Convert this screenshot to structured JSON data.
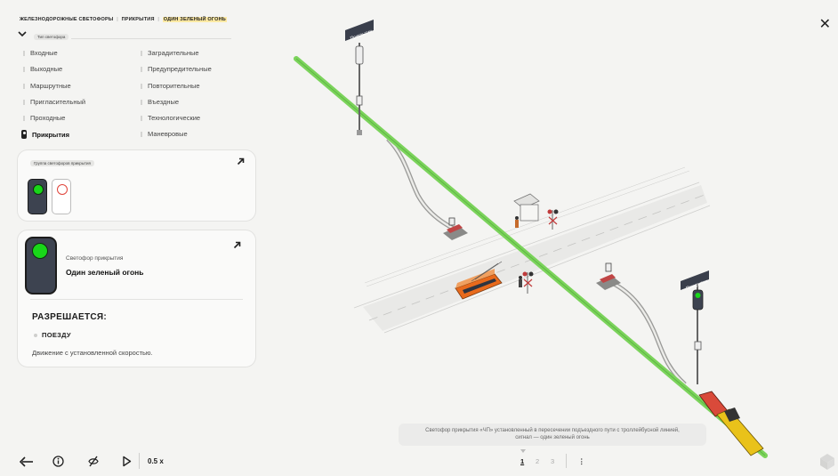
{
  "breadcrumb": {
    "part1": "Железнодорожные светофоры",
    "part2": "Прикрытия",
    "part3": "Один зеленый огонь",
    "sep": "|"
  },
  "close_label": "✕",
  "type_selector": {
    "chip_label": "Тип светофора"
  },
  "signal_types": {
    "left": [
      "Входные",
      "Выходные",
      "Маршрутные",
      "Пригласительный",
      "Проходные",
      "Прикрытия"
    ],
    "right": [
      "Заградительные",
      "Предупредительные",
      "Повторительные",
      "Въездные",
      "Технологические",
      "Маневровые"
    ],
    "active": "Прикрытия"
  },
  "group_card": {
    "chip_label": "Группа светофоров прикрытия"
  },
  "detail_card": {
    "sublabel": "Светофор прикрытия",
    "name": "Один зеленый огонь",
    "allowed_heading": "РАЗРЕШАЕТСЯ:",
    "target": "ПОЕЗДУ",
    "description": "Движение с установленной скоростью."
  },
  "scene": {
    "sign_top": "Прикрытия",
    "sign_right": "Прикрытия"
  },
  "caption": {
    "line1": "Светофор прикрытия «ЧП» установленный в пересечении подъездного пути с троллейбусной линией,",
    "line2": "сигнал — один зеленый огонь"
  },
  "controls": {
    "back_icon": "arrow-left-icon",
    "info_icon": "info-icon",
    "hide_icon": "eye-off-icon",
    "play_icon": "play-icon",
    "speed": "0.5 x"
  },
  "pagination": {
    "pages": [
      "1",
      "2",
      "3"
    ],
    "current": "1",
    "more": "⋮"
  },
  "colors": {
    "track_highlight": "#7bd35b",
    "lamp_green": "#19d619",
    "lamp_red": "#e0443a",
    "signal_body": "#3d4350",
    "trolleybus": "#e86a1c",
    "locomotive": "#e9c21a"
  }
}
